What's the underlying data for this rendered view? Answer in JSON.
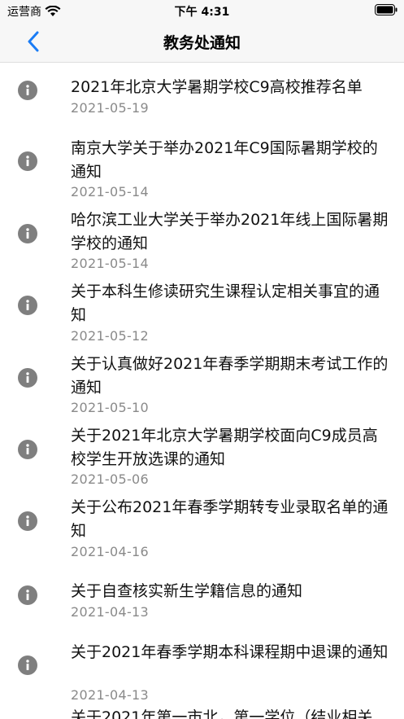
{
  "status_bar": {
    "carrier": "运营商",
    "time": "下午 4:31"
  },
  "nav": {
    "title": "教务处通知"
  },
  "notices": [
    {
      "title": "2021年北京大学暑期学校C9高校推荐名单",
      "date": "2021-05-19"
    },
    {
      "title": "南京大学关于举办2021年C9国际暑期学校的通知",
      "date": "2021-05-14"
    },
    {
      "title": "哈尔滨工业大学关于举办2021年线上国际暑期学校的通知",
      "date": "2021-05-14"
    },
    {
      "title": "关于本科生修读研究生课程认定相关事宜的通知",
      "date": "2021-05-12"
    },
    {
      "title": "关于认真做好2021年春季学期期末考试工作的通知",
      "date": "2021-05-10"
    },
    {
      "title": "关于2021年北京大学暑期学校面向C9成员高校学生开放选课的通知",
      "date": "2021-05-06"
    },
    {
      "title": "关于公布2021年春季学期转专业录取名单的通知",
      "date": "2021-04-16"
    },
    {
      "title": "关于自查核实新生学籍信息的通知",
      "date": "2021-04-13"
    },
    {
      "title": "关于2021年春季学期本科课程期中退课的通知",
      "date": "2021-04-13"
    }
  ],
  "partial_row_title": "关于2021年第一市北，第一学位（结业相关",
  "colors": {
    "accent": "#1a7cf5",
    "icon_gray": "#7f7f7f",
    "date_gray": "#8a8a8a"
  }
}
